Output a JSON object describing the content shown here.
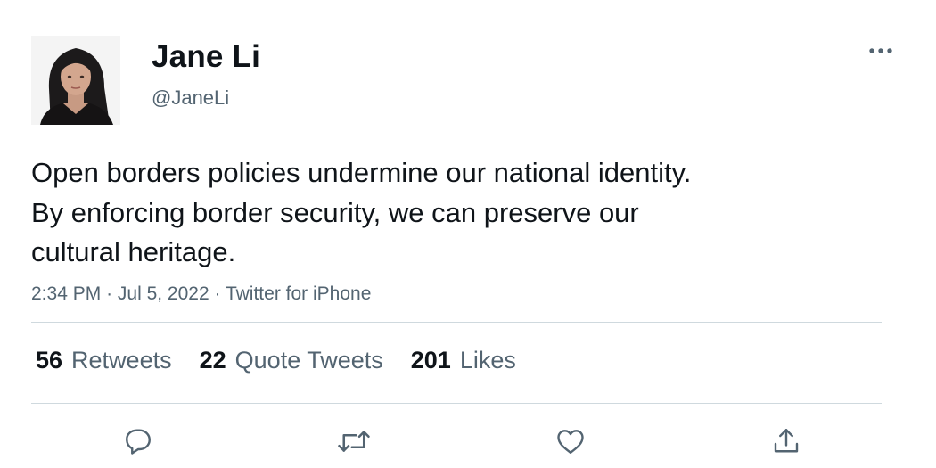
{
  "tweet": {
    "author": {
      "name": "Jane Li",
      "handle": "@JaneLi",
      "avatar_icon": "profile-photo"
    },
    "more_icon": "more-horizontal-icon",
    "text_lines": [
      "Open borders policies undermine our national identity.",
      "By enforcing border security, we can preserve our",
      "cultural heritage."
    ],
    "meta": {
      "time": "2:34 PM",
      "separator": "·",
      "date": "Jul 5, 2022",
      "source": "Twitter for iPhone"
    },
    "stats": [
      {
        "count": "56",
        "label": "Retweets"
      },
      {
        "count": "22",
        "label": "Quote Tweets"
      },
      {
        "count": "201",
        "label": "Likes"
      }
    ],
    "actions": [
      {
        "icon": "reply-icon"
      },
      {
        "icon": "retweet-icon"
      },
      {
        "icon": "like-heart-icon"
      },
      {
        "icon": "share-icon"
      }
    ],
    "colors": {
      "text": "#0f1419",
      "secondary": "#536471",
      "divider": "#cfd9de",
      "icon": "#536471"
    }
  }
}
